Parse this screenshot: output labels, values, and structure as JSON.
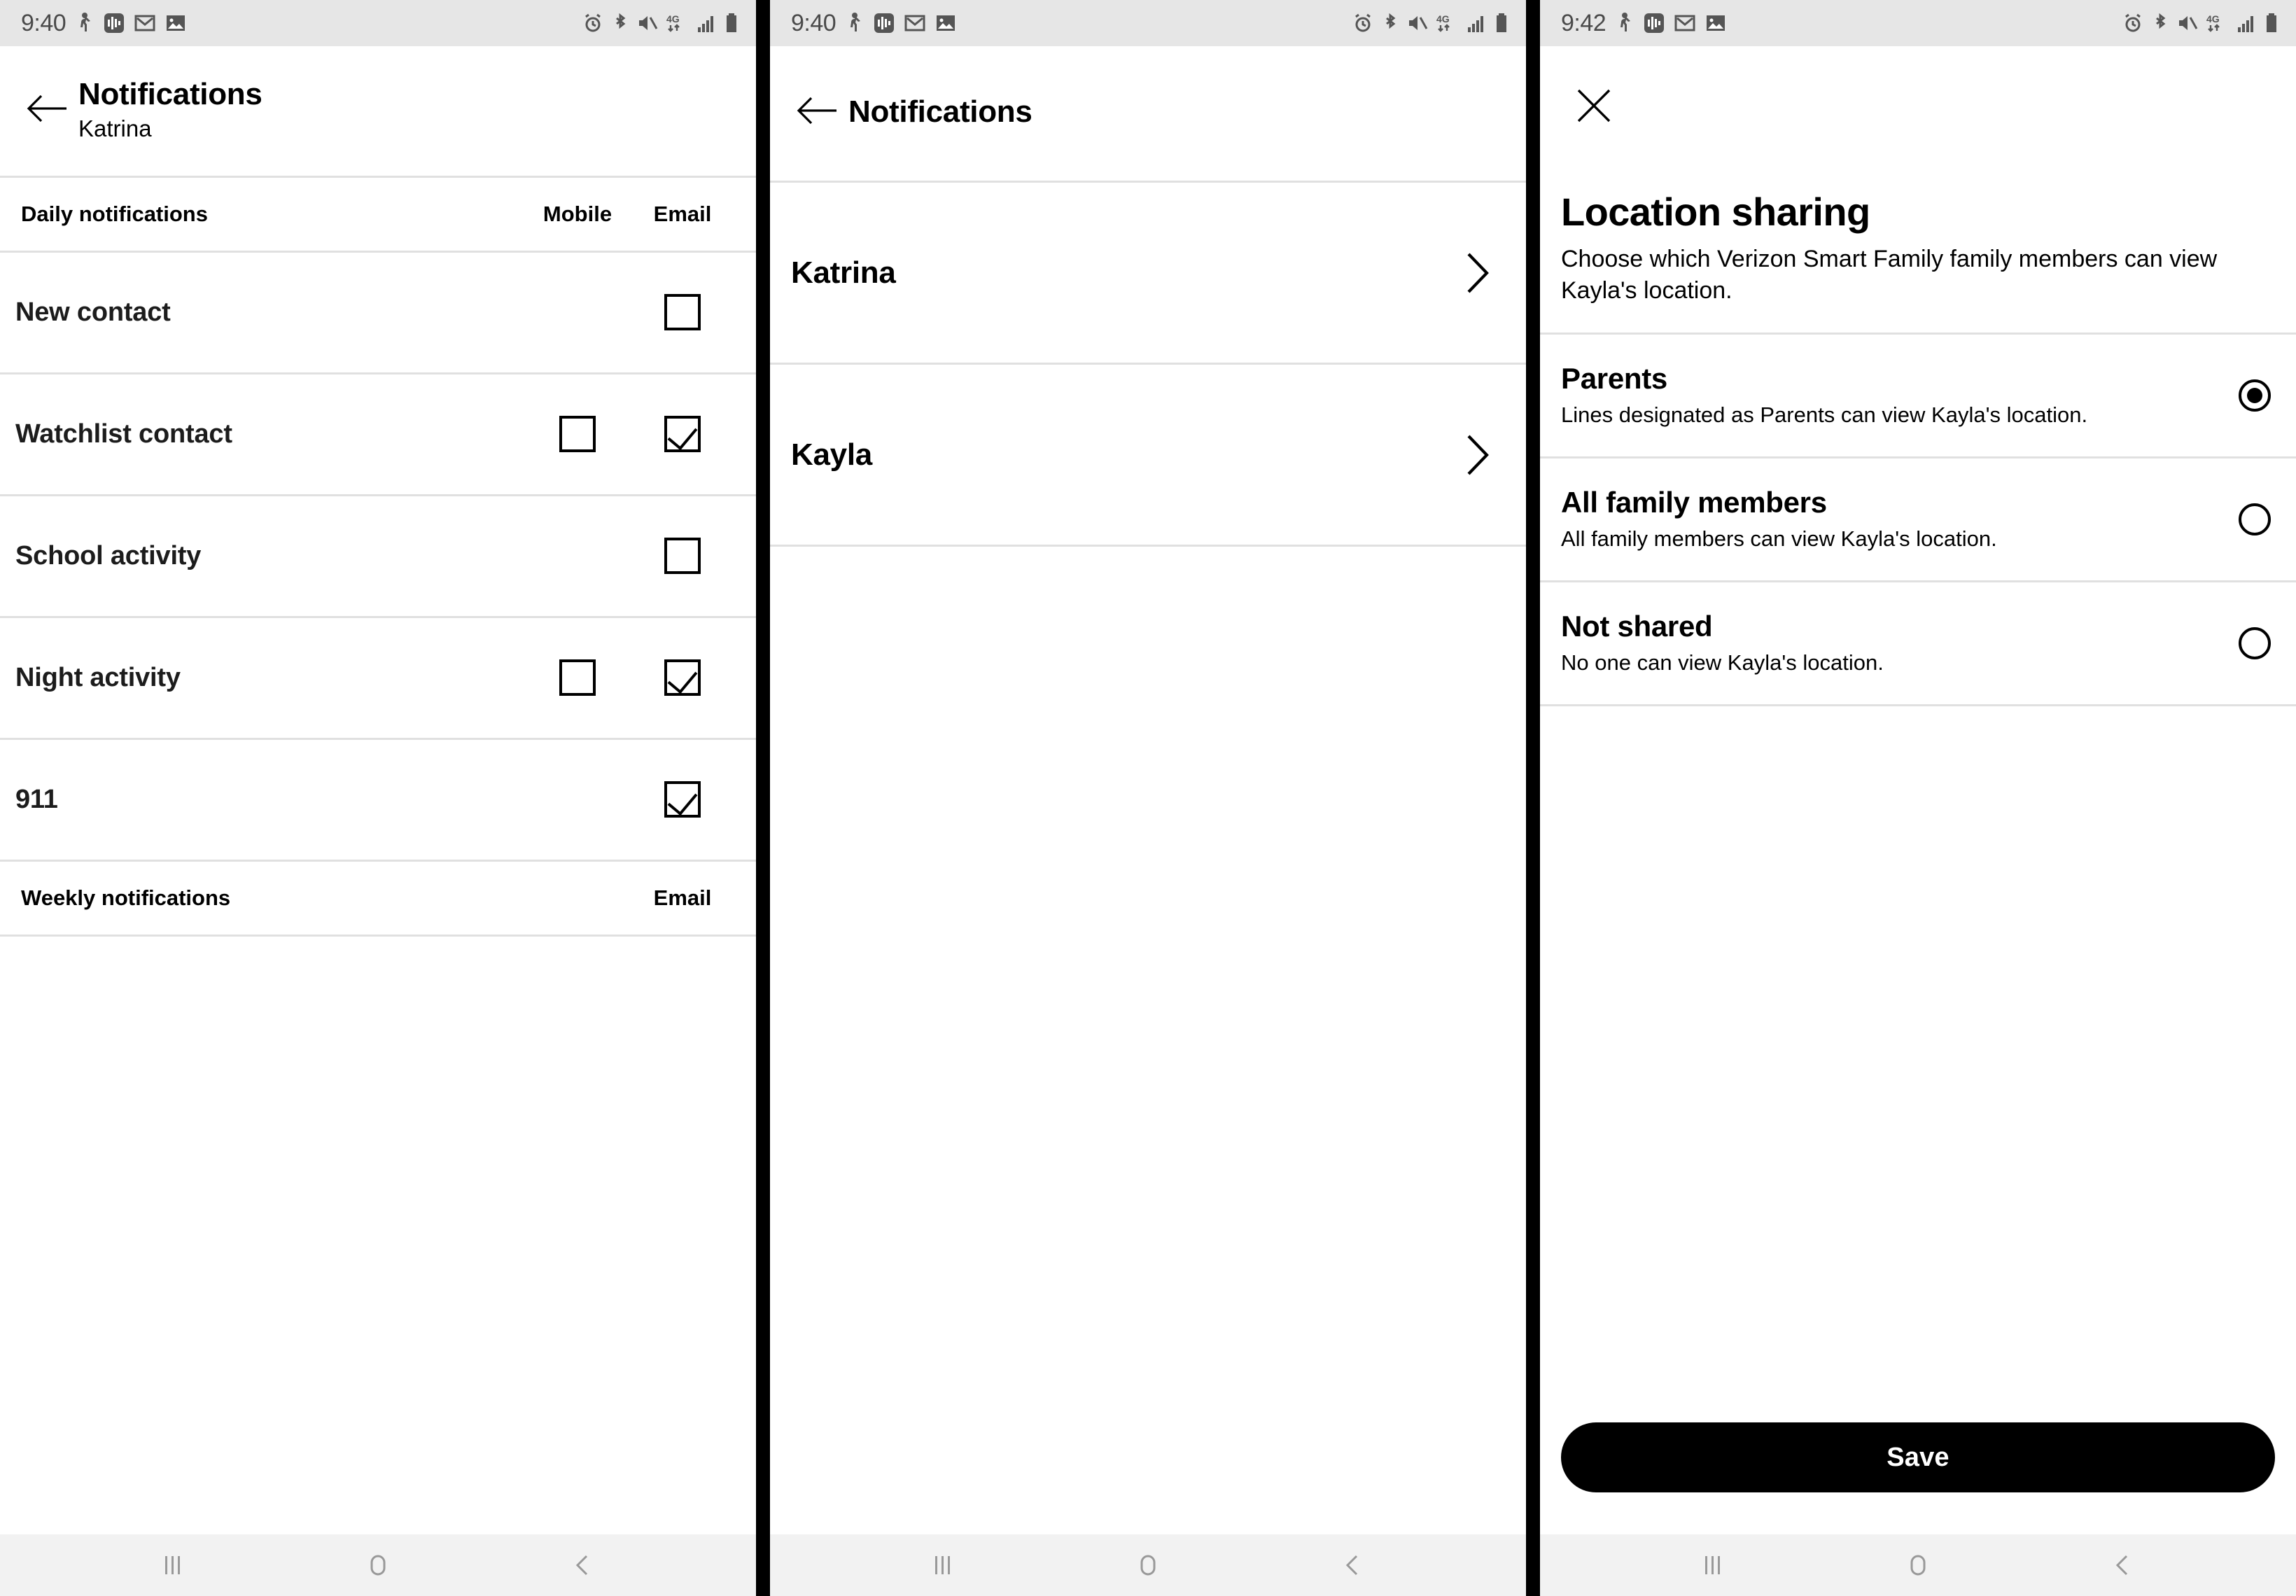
{
  "colors": {
    "statusbar_bg": "#e6e6e6",
    "navbar_bg": "#f2f2f2",
    "divider": "#e0e0e0",
    "accent": "#000000",
    "text": "#000000"
  },
  "panel1": {
    "statusbar": {
      "time": "9:40"
    },
    "appbar": {
      "back_icon": "arrow-left-icon",
      "title": "Notifications",
      "subtitle": "Katrina"
    },
    "table": {
      "section_label": "Daily notifications",
      "col_mobile": "Mobile",
      "col_email": "Email",
      "rows": [
        {
          "label": "New contact",
          "mobile": null,
          "email": false
        },
        {
          "label": "Watchlist contact",
          "mobile": false,
          "email": true
        },
        {
          "label": "School activity",
          "mobile": null,
          "email": false
        },
        {
          "label": "Night activity",
          "mobile": false,
          "email": true
        },
        {
          "label": "911",
          "mobile": null,
          "email": true
        }
      ],
      "weekly_label": "Weekly notifications",
      "weekly_col_email": "Email"
    }
  },
  "panel2": {
    "statusbar": {
      "time": "9:40"
    },
    "appbar": {
      "back_icon": "arrow-left-icon",
      "title": "Notifications"
    },
    "people": [
      {
        "name": "Katrina",
        "chevron_icon": "chevron-right-icon"
      },
      {
        "name": "Kayla",
        "chevron_icon": "chevron-right-icon"
      }
    ]
  },
  "panel3": {
    "statusbar": {
      "time": "9:42"
    },
    "close_icon": "close-icon",
    "title": "Location sharing",
    "description": "Choose which Verizon Smart Family family members can view Kayla's location.",
    "options": [
      {
        "name": "Parents",
        "desc": "Lines designated as Parents can view Kayla's location.",
        "selected": true
      },
      {
        "name": "All family members",
        "desc": "All family members can view Kayla's location.",
        "selected": false
      },
      {
        "name": "Not shared",
        "desc": "No one can view Kayla's location.",
        "selected": false
      }
    ],
    "save_label": "Save"
  },
  "navbar": {
    "recents_icon": "recents-icon",
    "home_icon": "home-icon",
    "back_icon": "back-chevron-icon"
  },
  "status_icons": [
    "person-walking-icon",
    "sound-wave-icon",
    "gmail-icon",
    "photo-icon",
    "alarm-icon",
    "bluetooth-icon",
    "mute-icon",
    "4g-lte-icon",
    "signal-bars-icon",
    "battery-icon"
  ]
}
